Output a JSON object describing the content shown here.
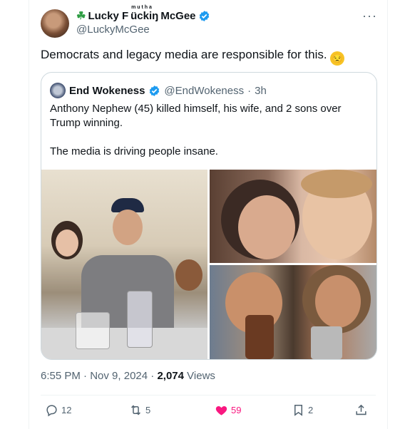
{
  "tweet": {
    "author_name_prefix": "Lucky F",
    "author_name_censored": "ückiŋ",
    "author_name_superscript": "m u t h a",
    "author_name_suffix": "McGee",
    "author_handle": "@LuckyMcGee",
    "text": "Democrats and legacy media are responsible for this.",
    "emoji": "😒",
    "time": "6:55 PM",
    "date": "Nov 9, 2024",
    "views_count": "2,074",
    "views_label": "Views",
    "more_glyph": "···"
  },
  "quote": {
    "author_name": "End Wokeness",
    "author_handle": "@EndWokeness",
    "age": "3h",
    "line1": "Anthony Nephew (45) killed himself, his wife, and 2 sons over Trump winning.",
    "line2": "The media is driving people insane."
  },
  "actions": {
    "replies": "12",
    "reposts": "5",
    "likes": "59",
    "bookmarks": "2"
  },
  "colors": {
    "verified": "#1d9bf0",
    "like": "#f91880",
    "muted_text": "#536471"
  }
}
